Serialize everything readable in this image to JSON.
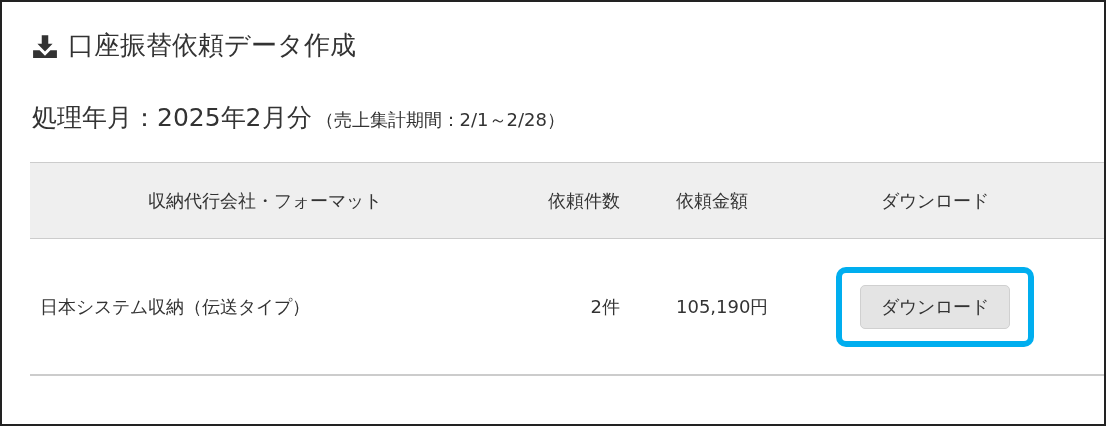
{
  "title": "口座振替依頼データ作成",
  "period": {
    "label": "処理年月：2025年2月分",
    "note": "（売上集計期間：2/1～2/28）"
  },
  "table": {
    "columns": [
      "収納代行会社・フォーマット",
      "依頼件数",
      "依頼金額",
      "ダウンロード"
    ],
    "rows": [
      {
        "company": "日本システム収納（伝送タイプ）",
        "count": "2件",
        "amount": "105,190円",
        "button": "ダウンロード",
        "highlighted": true
      }
    ]
  }
}
